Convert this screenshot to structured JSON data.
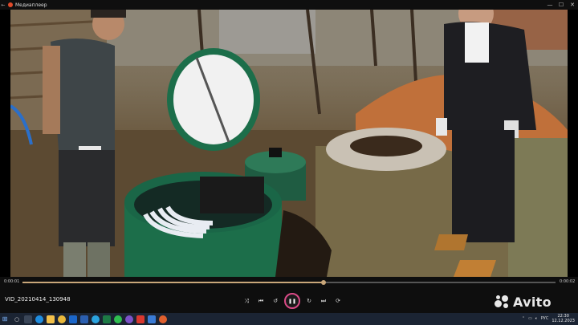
{
  "window": {
    "title": "Медиаплеер",
    "buttons": {
      "minimize": "—",
      "maximize": "☐",
      "close": "✕"
    }
  },
  "player": {
    "time_elapsed": "0:00:01",
    "time_total": "0:00:02",
    "progress": 0.565,
    "file_name": "VID_20210414_130948",
    "accent_color": "#d94a86",
    "controls": [
      "shuffle-icon",
      "previous-icon",
      "rewind-10-icon",
      "pause-icon",
      "forward-30-icon",
      "next-icon",
      "repeat-icon"
    ]
  },
  "watermark": {
    "text": "Avito"
  },
  "taskbar": {
    "apps": [
      "search-icon",
      "task-view-icon",
      "edge-icon",
      "files-icon",
      "chrome-icon",
      "outlook-icon",
      "word-icon",
      "telegram-icon",
      "excel-icon",
      "whatsapp-icon",
      "viber-icon",
      "antivirus-icon",
      "store-icon",
      "media-player-icon"
    ],
    "language": "РУС",
    "time": "22:30",
    "date": "12.12.2023"
  }
}
